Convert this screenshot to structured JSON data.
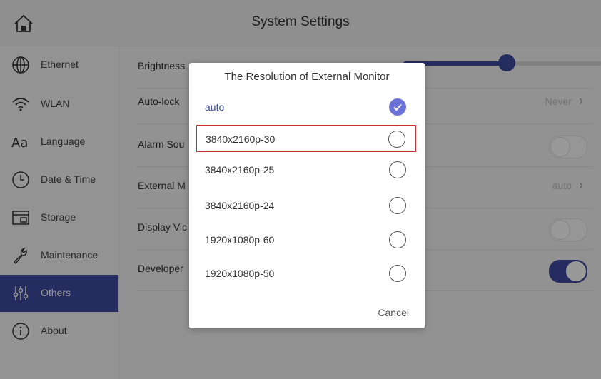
{
  "header": {
    "title": "System Settings"
  },
  "sidebar": {
    "items": [
      {
        "label": "Ethernet",
        "icon": "globe-icon"
      },
      {
        "label": "WLAN",
        "icon": "wifi-icon"
      },
      {
        "label": "Language",
        "icon": "language-icon"
      },
      {
        "label": "Date & Time",
        "icon": "clock-icon"
      },
      {
        "label": "Storage",
        "icon": "storage-icon"
      },
      {
        "label": "Maintenance",
        "icon": "wrench-icon"
      },
      {
        "label": "Others",
        "icon": "sliders-icon",
        "active": true
      },
      {
        "label": "About",
        "icon": "info-icon"
      }
    ]
  },
  "settings": {
    "brightness": {
      "label": "Brightness",
      "level": 0.52
    },
    "autolock": {
      "label": "Auto-lock",
      "value": "Never"
    },
    "alarm_sound": {
      "label": "Alarm Sou",
      "on": false
    },
    "external_monitor": {
      "label": "External M",
      "value": "auto"
    },
    "display_video": {
      "label": "Display Vic",
      "on": false
    },
    "developer": {
      "label": "Developer",
      "on": true
    }
  },
  "dialog": {
    "title": "The Resolution of External Monitor",
    "options": [
      {
        "label": "auto",
        "selected": true
      },
      {
        "label": "3840x2160p-30",
        "selected": false,
        "highlighted": true
      },
      {
        "label": "3840x2160p-25",
        "selected": false
      },
      {
        "label": "3840x2160p-24",
        "selected": false
      },
      {
        "label": "1920x1080p-60",
        "selected": false
      },
      {
        "label": "1920x1080p-50",
        "selected": false
      }
    ],
    "cancel_label": "Cancel"
  },
  "colors": {
    "accent": "#3c4aa0",
    "check": "#6b73d8",
    "highlight_border": "#d32f2f"
  }
}
